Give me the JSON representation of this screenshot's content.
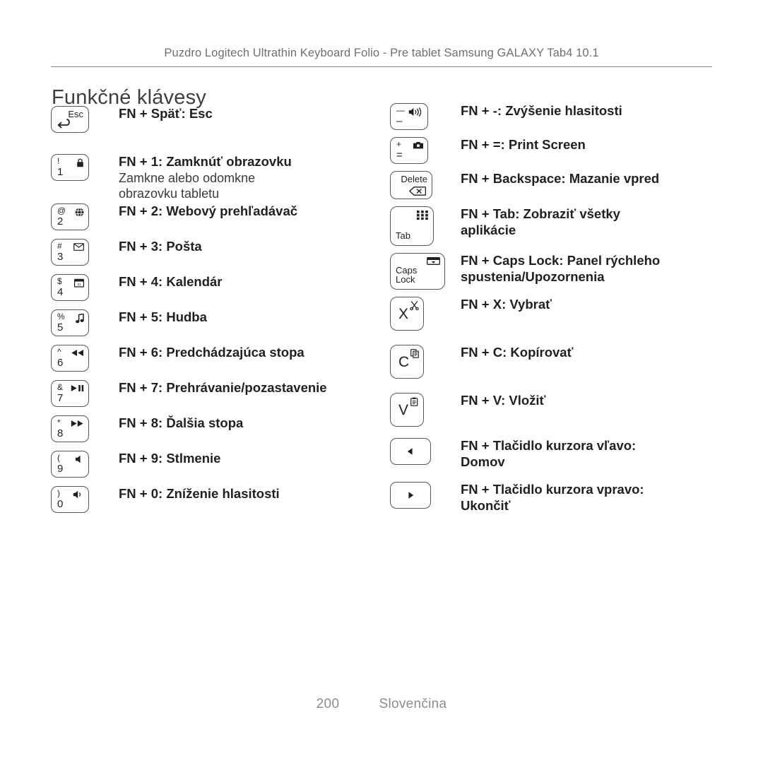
{
  "header": {
    "breadcrumb": "Puzdro Logitech Ultrathin Keyboard Folio - Pre tablet Samsung GALAXY Tab4 10.1",
    "title": "Funkčné klávesy"
  },
  "footer": {
    "page_number": "200",
    "language": "Slovenčina"
  },
  "colors": {
    "text": "#231f20",
    "muted": "#6f6f72",
    "rule": "#8a8a8d",
    "key_border": "#58585b",
    "footer": "#8e8b92"
  },
  "left_column": [
    {
      "key": {
        "style": "wide",
        "top_left": "",
        "bottom_left": "",
        "esc_label": "Esc",
        "icon": "back-arrow-icon"
      },
      "desc": " FN + Späť: Esc",
      "sub": ""
    },
    {
      "key": {
        "style": "wide",
        "top_left": "!",
        "bottom_left": "1",
        "icon": "lock-icon"
      },
      "desc": "FN + 1: Zamknúť obrazovku",
      "sub": "Zamkne alebo odomkne\nobrazovku tabletu"
    },
    {
      "key": {
        "style": "wide",
        "top_left": "@",
        "bottom_left": "2",
        "icon": "globe-browser-icon"
      },
      "desc": "FN + 2: Webový prehľadávač",
      "sub": ""
    },
    {
      "key": {
        "style": "wide",
        "top_left": "#",
        "bottom_left": "3",
        "icon": "envelope-icon"
      },
      "desc": "FN + 3: Pošta",
      "sub": ""
    },
    {
      "key": {
        "style": "wide",
        "top_left": "$",
        "bottom_left": "4",
        "icon": "calendar-icon"
      },
      "desc": "FN + 4: Kalendár",
      "sub": ""
    },
    {
      "key": {
        "style": "wide",
        "top_left": "%",
        "bottom_left": "5",
        "icon": "music-note-icon"
      },
      "desc": "FN + 5: Hudba",
      "sub": ""
    },
    {
      "key": {
        "style": "wide",
        "top_left": "^",
        "bottom_left": "6",
        "icon": "rewind-icon"
      },
      "desc": "FN + 6: Predchádzajúca stopa",
      "sub": ""
    },
    {
      "key": {
        "style": "wide",
        "top_left": "&",
        "bottom_left": "7",
        "icon": "play-pause-icon"
      },
      "desc": "FN + 7: Prehrávanie/pozastavenie",
      "sub": ""
    },
    {
      "key": {
        "style": "wide",
        "top_left": "*",
        "bottom_left": "8",
        "icon": "fast-forward-icon"
      },
      "desc": "FN + 8: Ďalšia stopa",
      "sub": ""
    },
    {
      "key": {
        "style": "wide",
        "top_left": "(",
        "bottom_left": "9",
        "icon": "mute-icon"
      },
      "desc": "FN + 9: Stlmenie",
      "sub": ""
    },
    {
      "key": {
        "style": "wide",
        "top_left": ")",
        "bottom_left": "0",
        "icon": "volume-down-icon"
      },
      "desc": "FN + 0: Zníženie hlasitosti",
      "sub": ""
    }
  ],
  "right_column": [
    {
      "key": {
        "style": "wide",
        "top_left": "—",
        "bottom_left": "–",
        "icon": "volume-up-icon"
      },
      "desc": "FN + -: Zvýšenie hlasitosti",
      "sub": ""
    },
    {
      "key": {
        "style": "wide",
        "top_left": "+",
        "bottom_left": "=",
        "icon": "camera-icon"
      },
      "desc": "FN + =: Print Screen",
      "sub": ""
    },
    {
      "key": {
        "style": "del",
        "word_top": "Delete",
        "icon": "backspace-icon"
      },
      "desc": "FN + Backspace: Mazanie vpred",
      "sub": ""
    },
    {
      "key": {
        "style": "tab",
        "word_left": "Tab",
        "icon": "app-grid-icon"
      },
      "desc": "FN + Tab: Zobraziť všetky\naplikácie",
      "sub": ""
    },
    {
      "key": {
        "style": "caps",
        "word_left": "Caps\nLock",
        "icon": "notification-panel-icon"
      },
      "desc": "FN + Caps Lock: Panel rýchleho\nspustenia/Upozornenia",
      "sub": ""
    },
    {
      "key": {
        "style": "sq",
        "letter": "X",
        "icon": "scissors-icon"
      },
      "desc": "FN + X: Vybrať",
      "sub": ""
    },
    {
      "key": {
        "style": "sq",
        "letter": "C",
        "icon": "copy-icon"
      },
      "desc": "FN + C: Kopírovať",
      "sub": ""
    },
    {
      "key": {
        "style": "sq",
        "letter": "V",
        "icon": "paste-icon"
      },
      "desc": "FN + V: Vložiť",
      "sub": ""
    },
    {
      "key": {
        "style": "arrow",
        "icon": "arrow-left-icon"
      },
      "desc": "FN + Tlačidlo kurzora vľavo:\nDomov",
      "sub": ""
    },
    {
      "key": {
        "style": "arrow",
        "icon": "arrow-right-icon"
      },
      "desc": "FN + Tlačidlo kurzora vpravo:\nUkončiť",
      "sub": ""
    }
  ]
}
